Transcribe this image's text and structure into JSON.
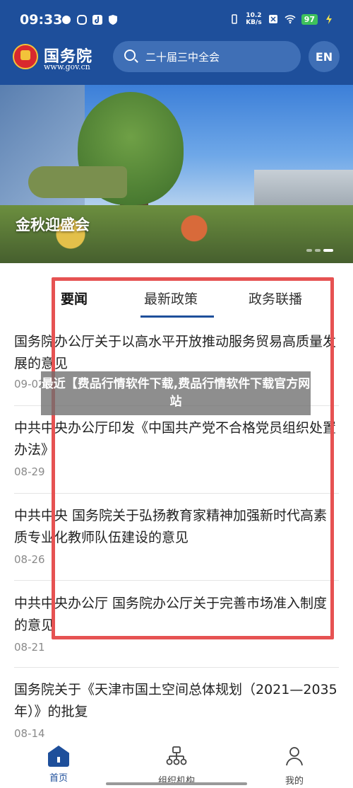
{
  "status_bar": {
    "time": "09:33",
    "net_speed_value": "10.2",
    "net_speed_unit": "KB/s",
    "battery": "97"
  },
  "header": {
    "site_name": "国务院",
    "site_url": "www.gov.cn",
    "search_placeholder": "二十届三中全会",
    "lang_label": "EN",
    "colors": {
      "primary": "#1e4f9b",
      "search_bg": "#3f6fb6"
    }
  },
  "banner": {
    "caption": "金秋迎盛会"
  },
  "tabs": [
    {
      "label": "要闻",
      "selected": false
    },
    {
      "label": "最新政策",
      "selected": true
    },
    {
      "label": "政务联播",
      "selected": false
    }
  ],
  "news": [
    {
      "title": "国务院办公厅关于以高水平开放推动服务贸易高质量发展的意见",
      "date": "09-02"
    },
    {
      "title": "中共中央办公厅印发《中国共产党不合格党员组织处置办法》",
      "date": "08-29"
    },
    {
      "title": "中共中央 国务院关于弘扬教育家精神加强新时代高素质专业化教师队伍建设的意见",
      "date": "08-26"
    },
    {
      "title": "中共中央办公厅 国务院办公厅关于完善市场准入制度的意见",
      "date": "08-21"
    },
    {
      "title": "国务院关于《天津市国土空间总体规划（2021—2035年）》的批复",
      "date": "08-14"
    }
  ],
  "overlay": {
    "text": "最近【费品行情软件下载,费品行情软件下载官方网站"
  },
  "bottom_nav": [
    {
      "label": "首页",
      "icon": "home-icon",
      "active": true
    },
    {
      "label": "组织机构",
      "icon": "org-chart-icon",
      "active": false
    },
    {
      "label": "我的",
      "icon": "user-icon",
      "active": false
    }
  ],
  "highlight_color": "#e65252"
}
